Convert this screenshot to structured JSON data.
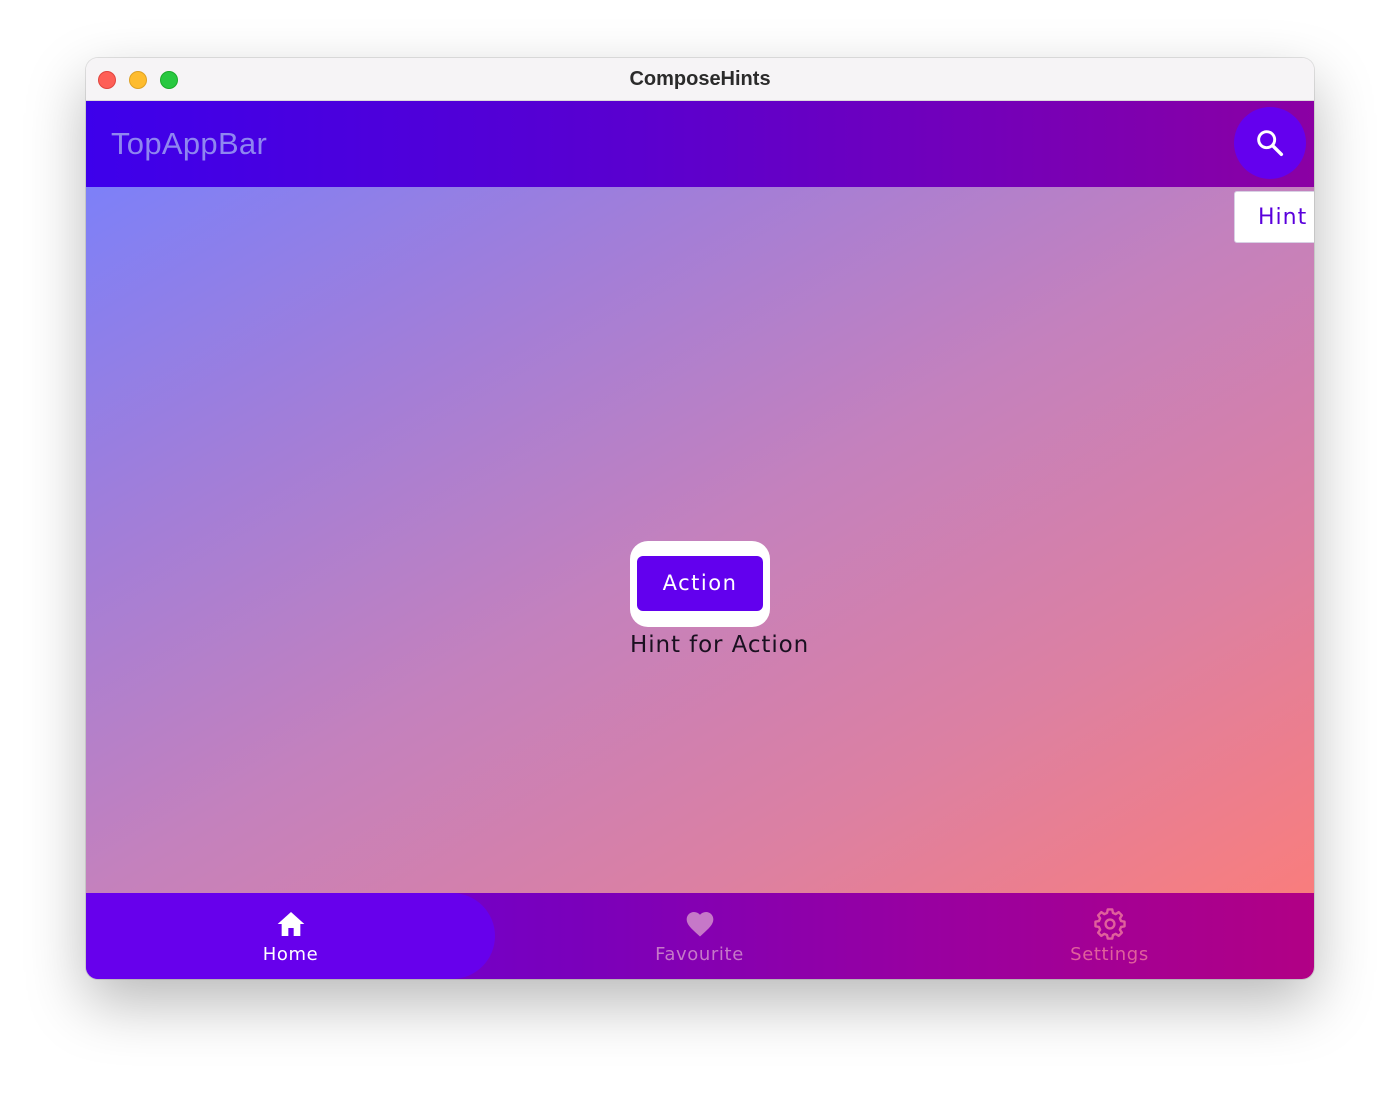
{
  "window": {
    "title": "ComposeHints"
  },
  "topbar": {
    "title": "TopAppBar",
    "search_icon": "search-icon"
  },
  "hint_popup": {
    "text": "Hint"
  },
  "main": {
    "action_label": "Action",
    "hint_text": "Hint for Action"
  },
  "bottom_nav": {
    "items": [
      {
        "label": "Home",
        "icon": "home-icon",
        "selected": true
      },
      {
        "label": "Favourite",
        "icon": "heart-icon",
        "selected": false
      },
      {
        "label": "Settings",
        "icon": "gear-icon",
        "selected": false
      }
    ]
  },
  "colors": {
    "primary": "#6200ee",
    "topbar_start": "#3d00eb",
    "topbar_end": "#8b00a3",
    "content_start": "#7d80f8",
    "content_end": "#f97d7d",
    "close": "#fe5f57",
    "minimize": "#febc2e",
    "maximize": "#28c840"
  }
}
